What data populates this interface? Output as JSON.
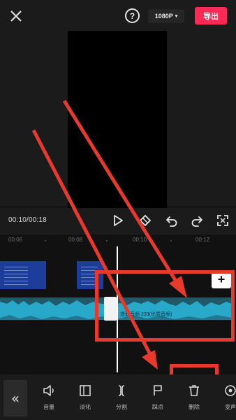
{
  "header": {
    "help_symbol": "?",
    "resolution": "1080P",
    "resolution_caret": "▾",
    "export_label": "导出"
  },
  "player": {
    "timecode": "00:10/00:18"
  },
  "timeline": {
    "ruler": [
      "00:06",
      "00:08",
      "00:10",
      "00:12"
    ],
    "add_clip_symbol": "+",
    "audio_label": "提取音频 233(优质音频)"
  },
  "toolbar": {
    "back_symbol": "«",
    "tools": [
      {
        "icon": "volume-icon",
        "label": "音量"
      },
      {
        "icon": "fade-icon",
        "label": "淡化"
      },
      {
        "icon": "split-icon",
        "label": "分割"
      },
      {
        "icon": "beat-icon",
        "label": "踩点"
      },
      {
        "icon": "delete-icon",
        "label": "删除"
      },
      {
        "icon": "voice-change-icon",
        "label": "变声"
      }
    ]
  },
  "colors": {
    "export": "#fd2a55",
    "audio_track": "#29a9c9",
    "annotation": "#e83a2c",
    "video_clip": "#1c3d99"
  }
}
